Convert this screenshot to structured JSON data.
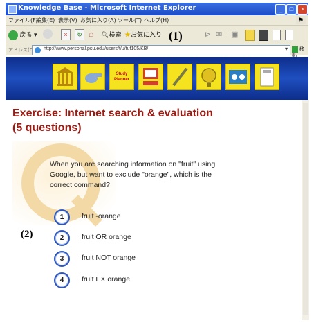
{
  "window": {
    "title": "Knowledge Base - Microsoft Internet Explorer",
    "controls": [
      "_",
      "□",
      "×"
    ]
  },
  "menu": [
    "ファイル(F)",
    "編集(E)",
    "表示(V)",
    "お気に入り(A)",
    "ツール(T)",
    "ヘルプ(H)"
  ],
  "toolbar": {
    "back_label": "戻る",
    "search_label": "検索",
    "favorites_label": "お気に入り"
  },
  "annotations": {
    "label1": "(1)",
    "label2": "(2)"
  },
  "address": {
    "label": "アドレス(D)",
    "url": "http://www.personal.psu.edu/users/t/u/tuf105/KB/",
    "go_label": "移動"
  },
  "banner": {
    "icons": [
      "library-icon",
      "whistle-icon",
      "study-planner-icon",
      "computer-icon",
      "pen-icon",
      "globe-icon",
      "feedback-icon",
      "calculator-icon"
    ],
    "study_planner_label": "Study Planner",
    "colors": {
      "background": "#1f4fc0",
      "icon": "#f4e31e"
    }
  },
  "exercise": {
    "title_line1": "Exercise: Internet search & evaluation",
    "title_line2": "(5 questions)",
    "question": "When you are searching information on \"fruit\" using Google, but want to exclude \"orange\", which is the correct command?",
    "options": [
      {
        "number": "1",
        "text": "fruit -orange"
      },
      {
        "number": "2",
        "text": "fruit OR orange"
      },
      {
        "number": "3",
        "text": "fruit NOT orange"
      },
      {
        "number": "4",
        "text": "fruit EX orange"
      }
    ],
    "title_color": "#9b1b12"
  }
}
